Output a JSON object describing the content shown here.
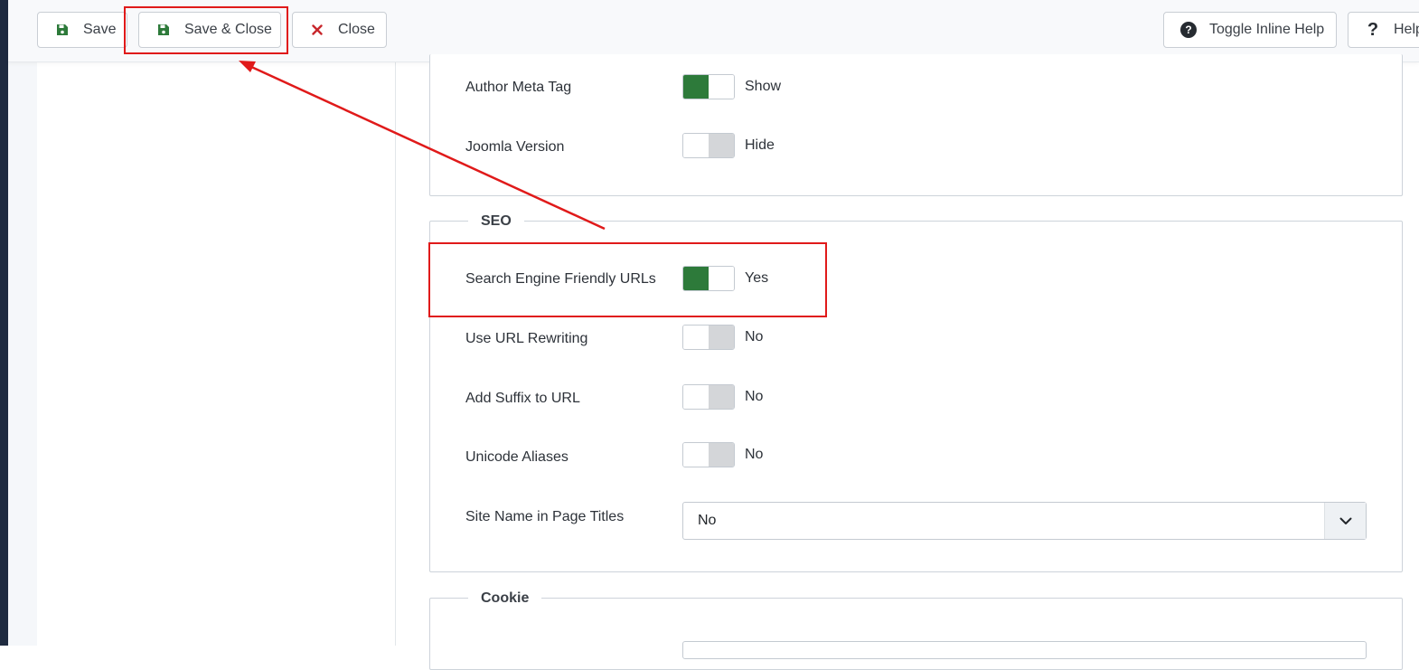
{
  "toolbar": {
    "save_label": "Save",
    "save_close_label": "Save & Close",
    "close_label": "Close",
    "toggle_help_label": "Toggle Inline Help",
    "help_label": "Help"
  },
  "colors": {
    "accent_green": "#2d7a3a",
    "close_red": "#c8272c",
    "annotation_red": "#e01a1a"
  },
  "metadata_fields": [
    {
      "label": "Author Meta Tag",
      "state": "Show",
      "on": true
    },
    {
      "label": "Joomla Version",
      "state": "Hide",
      "on": false
    }
  ],
  "seo": {
    "legend": "SEO",
    "fields": [
      {
        "label": "Search Engine Friendly URLs",
        "state": "Yes",
        "on": true
      },
      {
        "label": "Use URL Rewriting",
        "state": "No",
        "on": false
      },
      {
        "label": "Add Suffix to URL",
        "state": "No",
        "on": false
      },
      {
        "label": "Unicode Aliases",
        "state": "No",
        "on": false
      }
    ],
    "site_name_label": "Site Name in Page Titles",
    "site_name_value": "No"
  },
  "cookie": {
    "legend": "Cookie"
  },
  "icons": {
    "save": "save-icon",
    "close": "x-icon",
    "help_circle": "question-circle-icon",
    "help": "question-icon",
    "dropdown": "chevron-down-icon"
  }
}
